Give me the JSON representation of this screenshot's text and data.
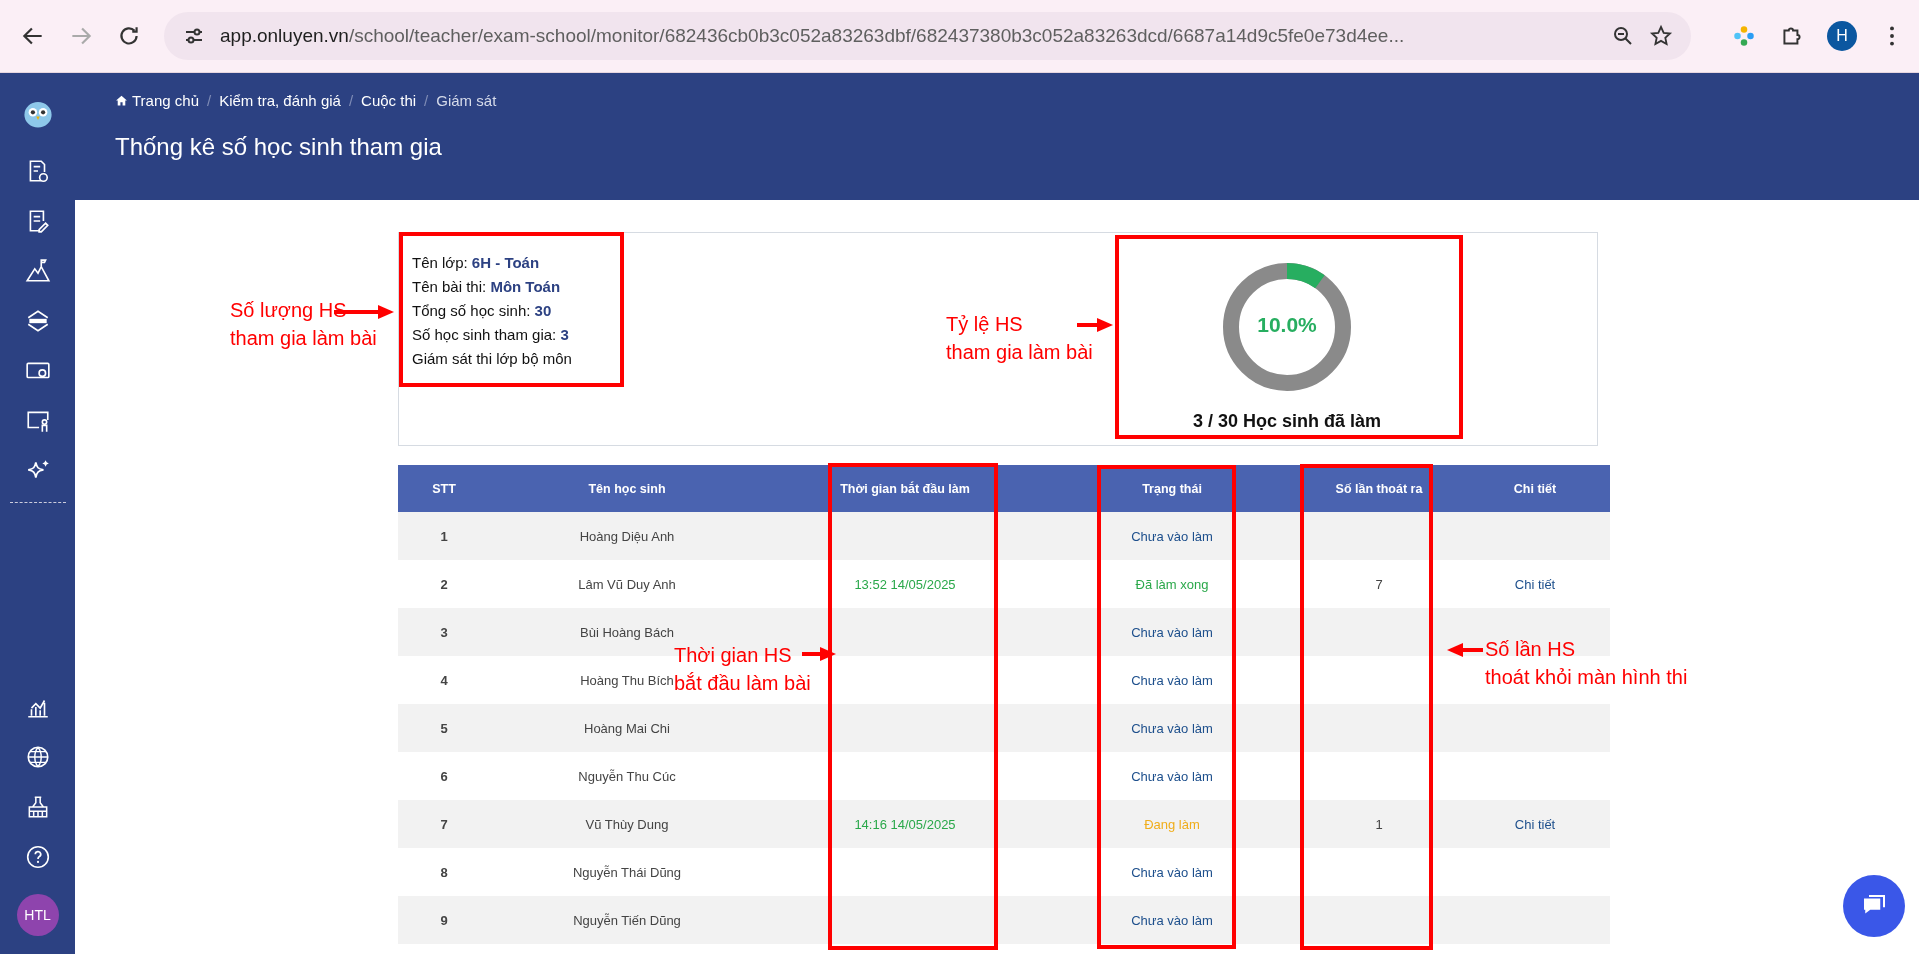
{
  "browser": {
    "url_host": "app.onluyen.vn",
    "url_path": "/school/teacher/exam-school/monitor/682436cb0b3c052a83263dbf/682437380b3c052a83263dcd/6687a14d9c5fe0e73d4ee...",
    "profile": "H"
  },
  "sidebar": {
    "avatar": "HTL"
  },
  "breadcrumb": [
    {
      "label": "Trang chủ"
    },
    {
      "separator": "/",
      "label": "Kiểm tra, đánh giá"
    },
    {
      "separator": "/",
      "label": "Cuộc thi"
    },
    {
      "separator": "/",
      "label": "Giám sát"
    }
  ],
  "page_title": "Thống kê số học sinh tham gia",
  "info": {
    "lines": [
      {
        "label": "Tên lớp:",
        "value": "6H - Toán"
      },
      {
        "label": "Tên bài thi:",
        "value": "Môn Toán"
      },
      {
        "label": "Tổng số học sinh:",
        "value": "30"
      },
      {
        "label": "Số học sinh tham gia:",
        "value": "3"
      },
      {
        "label": "Giám sát thi lớp bộ môn"
      }
    ]
  },
  "progress": {
    "level": 0.1,
    "percent": "10.0%",
    "caption": "3 / 30 Học sinh đã làm"
  },
  "table": {
    "columns": [
      "STT",
      "Tên học sinh",
      "Thời gian bắt đầu làm",
      "Trạng thái",
      "Số lần thoát ra",
      "Chi tiết"
    ],
    "rows": [
      {
        "stt": "1",
        "name": "Hoàng Diệu Anh",
        "status": "Chưa vào làm",
        "color": "#1d4f8c"
      },
      {
        "stt": "2",
        "name": "Lâm Vũ Duy Anh",
        "start_time": "13:52 14/05/2025",
        "status": "Đã làm xong",
        "color": "#2aa84a",
        "exits": "7",
        "detail": "Chi tiết"
      },
      {
        "stt": "3",
        "name": "Bùi Hoàng Bách",
        "status": "Chưa vào làm",
        "color": "#1d4f8c"
      },
      {
        "stt": "4",
        "name": "Hoàng Thu Bích",
        "status": "Chưa vào làm",
        "color": "#1d4f8c"
      },
      {
        "stt": "5",
        "name": "Hoàng Mai Chi",
        "status": "Chưa vào làm",
        "color": "#1d4f8c"
      },
      {
        "stt": "6",
        "name": "Nguyễn Thu Cúc",
        "status": "Chưa vào làm",
        "color": "#1d4f8c"
      },
      {
        "stt": "7",
        "name": "Vũ Thùy Dung",
        "start_time": "14:16 14/05/2025",
        "status": "Đang làm",
        "color": "#f0ad1a",
        "exits": "1",
        "detail": "Chi tiết"
      },
      {
        "stt": "8",
        "name": "Nguyễn Thái Dũng",
        "status": "Chưa vào làm",
        "color": "#1d4f8c"
      },
      {
        "stt": "9",
        "name": "Nguyễn Tiến Dũng",
        "status": "Chưa vào làm",
        "color": "#1d4f8c"
      }
    ]
  },
  "annotations": [
    {
      "lines": [
        "Số lượng HS",
        "tham gia làm bài"
      ]
    },
    {
      "lines": [
        "Tỷ lệ HS",
        "tham gia làm bài"
      ]
    },
    {
      "lines": [
        "Thời gian HS",
        "bắt đầu làm bài"
      ]
    },
    {
      "lines": [
        "Số lần HS",
        "thoát khỏi màn hình thi"
      ]
    }
  ]
}
